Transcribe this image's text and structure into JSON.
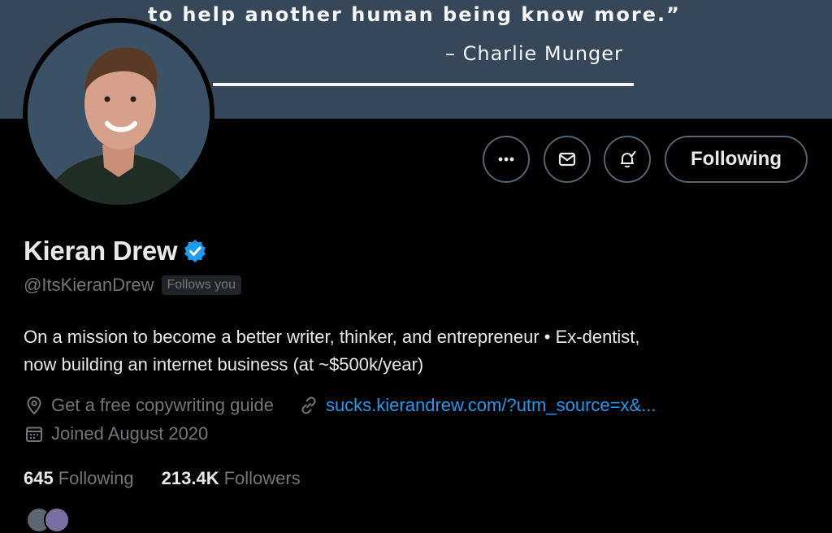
{
  "banner": {
    "quote_line": "to help another human being know more.”",
    "quote_author": "– Charlie Munger"
  },
  "actions": {
    "more_icon": "more-icon",
    "message_icon": "mail-icon",
    "notify_icon": "bell-check-icon",
    "following_label": "Following"
  },
  "profile": {
    "name": "Kieran Drew",
    "handle": "@ItsKieranDrew",
    "follows_you": "Follows you",
    "bio_line1": "On a mission to become a better writer, thinker, and entrepreneur • Ex-dentist,",
    "bio_line2": "now building an internet business (at ~$500k/year)",
    "location": "Get a free copywriting guide",
    "link": "sucks.kierandrew.com/?utm_source=x&...",
    "joined": "Joined August 2020"
  },
  "stats": {
    "following_count": "645",
    "following_label": "Following",
    "followers_count": "213.4K",
    "followers_label": "Followers"
  },
  "colors": {
    "accent": "#1d9bf0",
    "banner": "#364759",
    "muted": "#71767b"
  }
}
